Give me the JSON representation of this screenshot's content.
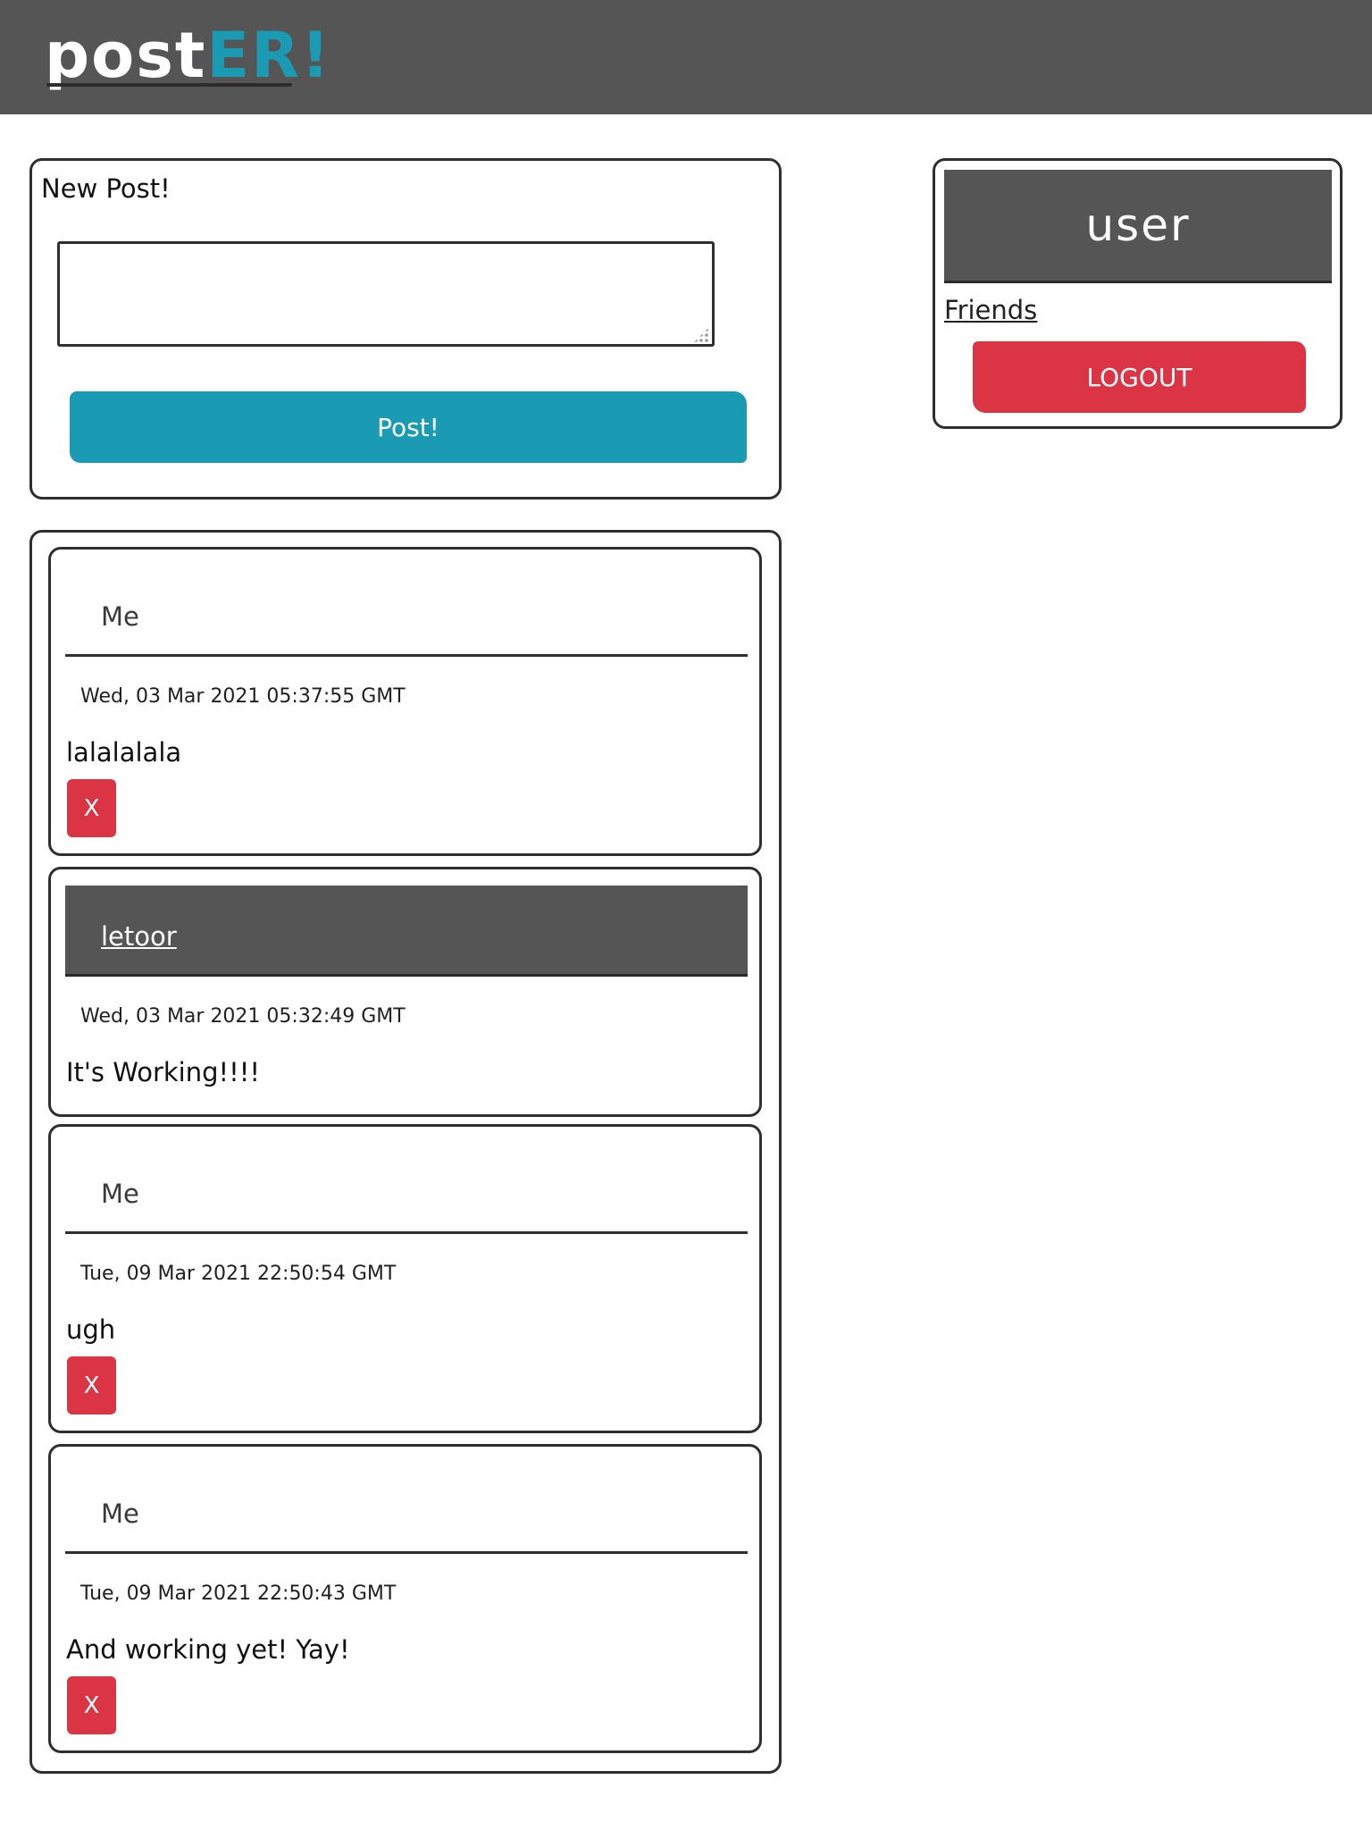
{
  "app": {
    "logo_part1": "post",
    "logo_part2": "ER!",
    "brand_color": "#1a9bb3",
    "header_color": "#555555",
    "danger_color": "#db3545"
  },
  "new_post": {
    "title": "New Post!",
    "textarea_value": "",
    "submit_label": "Post!"
  },
  "user_panel": {
    "username": "user",
    "friends_link": "Friends",
    "logout_label": "LOGOUT"
  },
  "feed": {
    "posts": [
      {
        "author": "Me",
        "date": "Wed, 03 Mar 2021 05:37:55 GMT",
        "body": "lalalalala",
        "delete_label": "X"
      },
      {
        "author": "letoor",
        "date": "Wed, 03 Mar 2021 05:32:49 GMT",
        "body": "It's Working!!!!"
      },
      {
        "author": "Me",
        "date": "Tue, 09 Mar 2021 22:50:54 GMT",
        "body": "ugh",
        "delete_label": "X"
      },
      {
        "author": "Me",
        "date": "Tue, 09 Mar 2021 22:50:43 GMT",
        "body": "And working yet! Yay!",
        "delete_label": "X"
      }
    ]
  }
}
